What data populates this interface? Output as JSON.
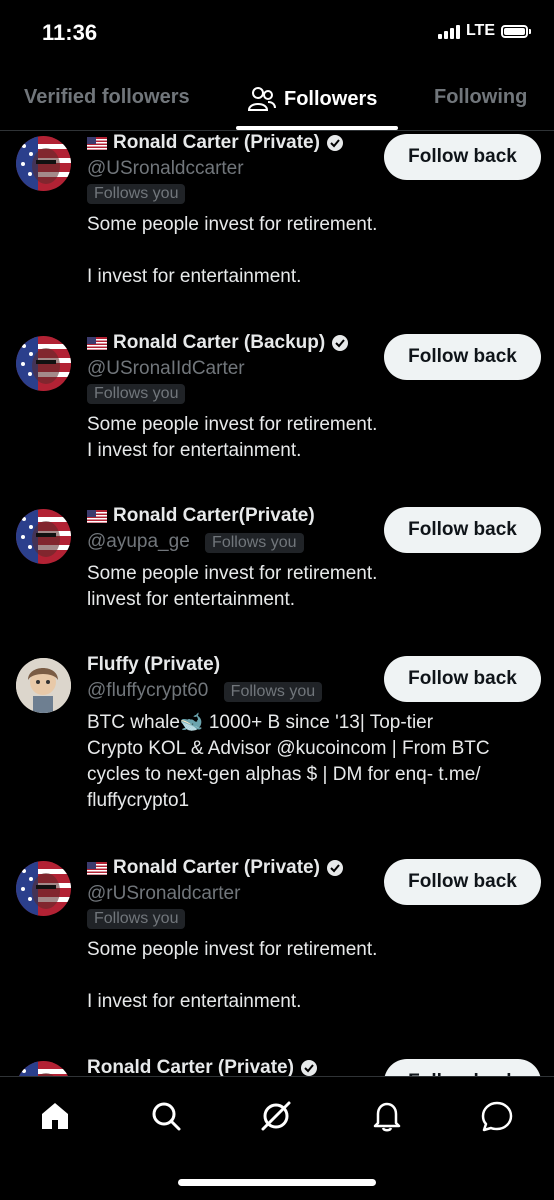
{
  "status": {
    "time": "11:36",
    "network": "LTE"
  },
  "tabs": [
    {
      "label": "Verified followers"
    },
    {
      "label": "Followers"
    },
    {
      "label": "Following"
    }
  ],
  "follows_you_label": "Follows you",
  "follow_back_label": "Follow back",
  "users": [
    {
      "name": "Ronald Carter (Private)",
      "handle": "@USronaldccarter",
      "bio": "Some people invest for retirement.\n\nI invest for entertainment."
    },
    {
      "name": "Ronald Carter (Backup)",
      "handle": "@USronaIIdCarter",
      "bio": "Some people invest for retirement.\nI invest for entertainment."
    },
    {
      "name": "Ronald Carter(Private)",
      "handle": "@ayupa_ge",
      "bio": "Some people invest for retirement.\nlinvest for entertainment."
    },
    {
      "name": "Fluffy (Private)",
      "handle": "@fluffycrypt60",
      "bio": "BTC whale🐋 1000+ B since '13| Top-tier\nCrypto KOL & Advisor @kucoincom | From BTC\ncycles to next-gen alphas $ | DM for enq- t.me/\nfluffycrypto1"
    },
    {
      "name": "Ronald Carter (Private)",
      "handle": "@rUSronaldcarter",
      "bio": "Some people invest for retirement.\n\nI invest for entertainment."
    },
    {
      "name": "Ronald Carter (Private)",
      "handle": "",
      "bio": ""
    }
  ],
  "icons": {
    "nav": [
      "home-icon",
      "search-icon",
      "grok-icon",
      "notifications-icon",
      "messages-icon"
    ],
    "badge": "verified-badge-icon",
    "flag": "us-flag-icon"
  },
  "colors": {
    "background": "#000000",
    "muted": "#71767b",
    "text": "#e7e9ea",
    "button": "#eff3f4"
  }
}
